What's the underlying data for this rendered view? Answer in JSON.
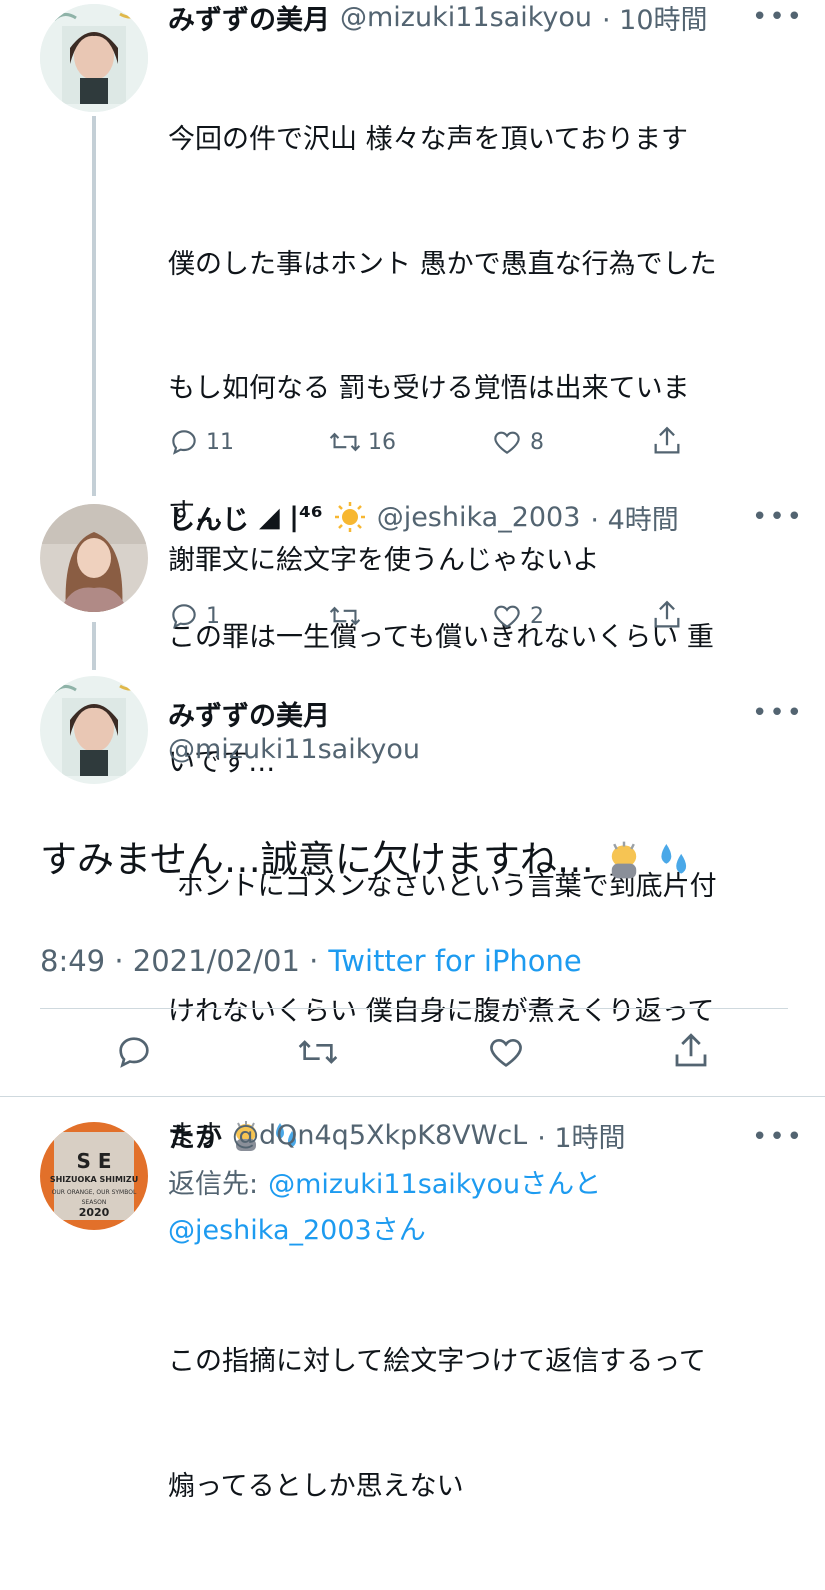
{
  "tweet1": {
    "name": "みずずの美月",
    "handle": "@mizuki11saikyou",
    "time": "· 10時間",
    "lines": [
      "今回の件で沢山 様々な声を頂いております",
      "僕のした事はホント 愚かで愚直な行為でした",
      "もし如何なる 罰も受ける覚悟は出来ていま",
      "す…",
      "この罪は一生償っても償いきれないくらい 重",
      "いです…",
      " ホントにゴメンなさいという言葉で到底片付",
      "けれないくらい 僕自身に腹が煮えくり返って",
      "ます"
    ],
    "reply_count": "11",
    "retweet_count": "16",
    "like_count": "8"
  },
  "tweet2": {
    "name": "しんじ",
    "name_suffix": "◢ |⁴⁶",
    "handle": "@jeshika_2003",
    "time": "· 4時間",
    "text": "謝罪文に絵文字を使うんじゃないよ",
    "reply_count": "1",
    "like_count": "2"
  },
  "main": {
    "name": "みずずの美月",
    "handle": "@mizuki11saikyou",
    "text": "すみません…誠意に欠けますね…",
    "time": "8:49 · 2021/02/01 ·",
    "source": "Twitter for iPhone"
  },
  "tweet3": {
    "name": "たか",
    "handle": "@dQn4q5XkpK8VWcL",
    "time": "· 1時間",
    "reply_prefix": "返信先:",
    "reply_to_1": "@mizuki11saikyouさんと",
    "reply_to_2": "@jeshika_2003さん",
    "line1": "この指摘に対して絵文字つけて返信するって",
    "line2": "煽ってるとしか思えない",
    "avatar_text_1": "S  E",
    "avatar_text_2": "SHIZUOKA SHIMIZU",
    "avatar_text_3": "OUR ORANGE, OUR SYMBOL",
    "avatar_text_4": "SEASON",
    "avatar_text_5": "2020"
  },
  "more_label": "•••",
  "colors": {
    "text": "#0f1419",
    "secondary": "#536471",
    "link": "#1d9bf0",
    "divider": "#cfd9de",
    "thread": "#c4cfd6"
  },
  "icons": [
    "reply-icon",
    "retweet-icon",
    "like-icon",
    "share-icon",
    "more-icon"
  ]
}
